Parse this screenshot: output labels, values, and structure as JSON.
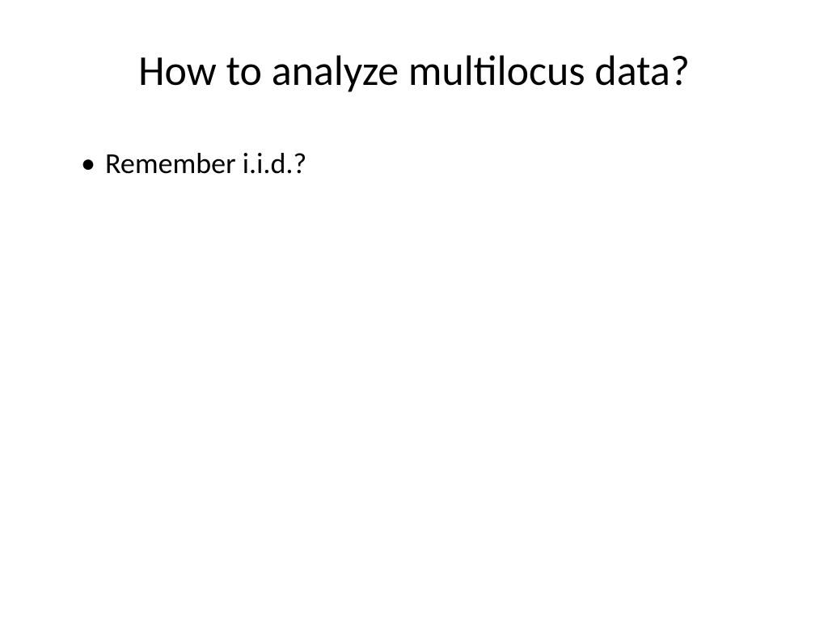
{
  "slide": {
    "title": "How to analyze multilocus data?",
    "bullets": [
      "Remember i.i.d.?"
    ]
  }
}
